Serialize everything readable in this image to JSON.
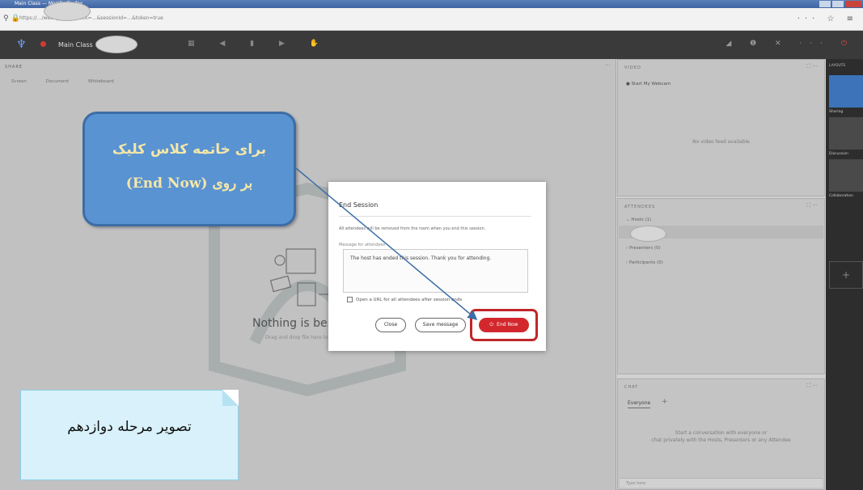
{
  "browser": {
    "tab_title": "Main Class — Mozilla Firefox",
    "url": "https://…/webapp-room?ack=…&sessionId=…&token=true"
  },
  "app": {
    "room_name": "Main Class",
    "share_pod_title": "SHARE",
    "share_bar": {
      "screen": "Screen",
      "document": "Document",
      "whiteboard": "Whiteboard"
    },
    "empty_title": "Nothing is bein",
    "empty_sub": "Drag and drop file here to"
  },
  "videos_pod": {
    "title": "VIDEO",
    "start_label": "Start My Webcam",
    "empty_text": "No video feed available"
  },
  "attendees_pod": {
    "title": "ATTENDEES",
    "hosts": "Hosts (1)",
    "presenters": "Presenters (0)",
    "participants": "Participants (0)"
  },
  "chat_pod": {
    "title": "CHAT",
    "tab": "Everyone",
    "empty_text_1": "Start a conversation with everyone or",
    "empty_text_2": "chat privately with the Hosts, Presenters or any Attendee",
    "input_placeholder": "Type here"
  },
  "layouts": {
    "title": "LAYOUTS",
    "items": [
      "Sharing",
      "Discussion",
      "Collaboration"
    ]
  },
  "dialog": {
    "title": "End Session",
    "info": "All attendees will be removed from the room when you end this session.",
    "message_label": "Message for attendees",
    "message": "The host has ended this session. Thank you for attending.",
    "url_option": "Open a URL for all attendees after session ends",
    "close_label": "Close",
    "save_label": "Save message",
    "end_label": "End Now"
  },
  "annotations": {
    "callout_line1": "برای خاتمه کلاس کلیک",
    "callout_line2": "(End Now) بر روی",
    "step_caption": "تصویر مرحله دوازدهم"
  },
  "colors": {
    "end_button": "#d2282d",
    "callout_blue": "#5a93d2",
    "callout_text": "#f4e7a8",
    "step_box": "#d8f1fb"
  }
}
